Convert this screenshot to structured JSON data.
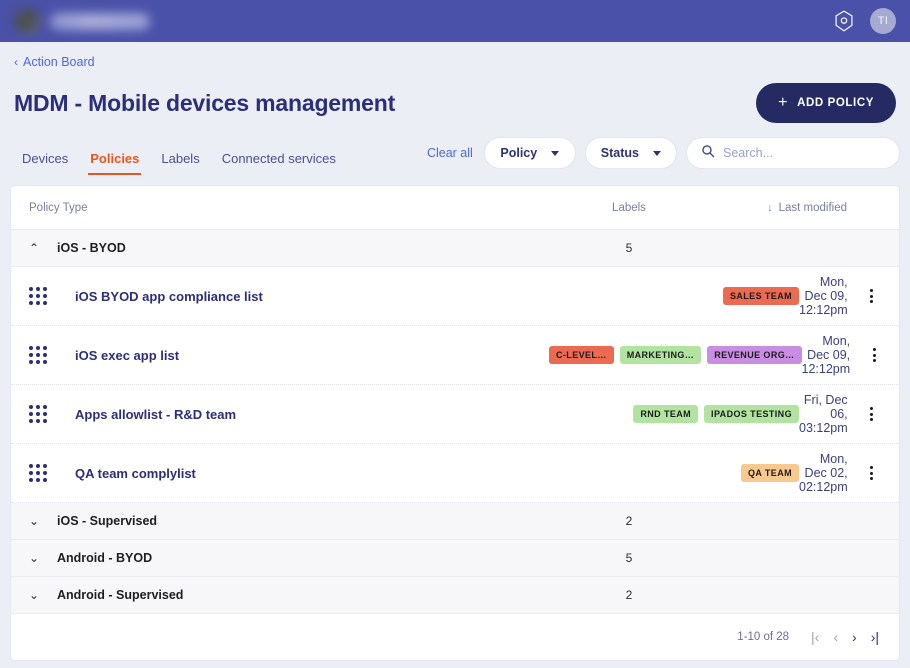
{
  "appbar": {
    "brand_label": "",
    "gear_icon": "gear-hex-icon",
    "avatar_initials": "TI"
  },
  "breadcrumb": {
    "chevron": "‹",
    "label": "Action Board"
  },
  "header": {
    "title": "MDM - Mobile devices management",
    "add_button": {
      "plus": "+",
      "label": "ADD POLICY"
    }
  },
  "tabs": [
    {
      "label": "Devices",
      "active": false
    },
    {
      "label": "Policies",
      "active": true
    },
    {
      "label": "Labels",
      "active": false
    },
    {
      "label": "Connected services",
      "active": false
    }
  ],
  "filters": {
    "clear_all": "Clear all",
    "policy_filter": "Policy",
    "status_filter": "Status",
    "search_placeholder": "Search...",
    "search_value": ""
  },
  "table": {
    "columns": {
      "name": "Policy Type",
      "labels": "Labels",
      "modified": "Last modified",
      "sort_arrow": "↓"
    },
    "groups": [
      {
        "name": "iOS - BYOD",
        "count": "5",
        "expanded": true,
        "chevron": "⌃",
        "rows": [
          {
            "name": "iOS BYOD app compliance list",
            "labels": [
              {
                "text": "SALES TEAM",
                "color": "#ea6a52"
              }
            ],
            "modified": "Mon, Dec 09, 12:12pm"
          },
          {
            "name": "iOS exec app list",
            "labels": [
              {
                "text": "C-LEVEL…",
                "color": "#ea6a52"
              },
              {
                "text": "MARKETING…",
                "color": "#b2e3a0"
              },
              {
                "text": "REVENUE ORG…",
                "color": "#c98ee2"
              }
            ],
            "modified": "Mon, Dec 09, 12:12pm"
          },
          {
            "name": "Apps allowlist - R&D team",
            "labels": [
              {
                "text": "RND TEAM",
                "color": "#b2e3a0"
              },
              {
                "text": "IPADOS TESTING",
                "color": "#b2e3a0"
              }
            ],
            "modified": "Fri, Dec 06, 03:12pm"
          },
          {
            "name": "QA team complylist",
            "labels": [
              {
                "text": "QA TEAM",
                "color": "#f7c98e"
              }
            ],
            "modified": "Mon, Dec 02, 02:12pm"
          }
        ]
      },
      {
        "name": "iOS - Supervised",
        "count": "2",
        "expanded": false,
        "chevron": "⌄",
        "rows": []
      },
      {
        "name": "Android - BYOD",
        "count": "5",
        "expanded": false,
        "chevron": "⌄",
        "rows": []
      },
      {
        "name": "Android - Supervised",
        "count": "2",
        "expanded": false,
        "chevron": "⌄",
        "rows": []
      }
    ]
  },
  "pagination": {
    "range": "1-10 of 28",
    "first": "|‹",
    "prev": "‹",
    "next": "›",
    "last": "›|"
  },
  "colors": {
    "appbar": "#4a51a8",
    "page_bg": "#eceef5",
    "title": "#2c2e77",
    "accent_active_tab": "#e8561f",
    "link": "#4a6ad4",
    "add_button": "#252a63"
  }
}
